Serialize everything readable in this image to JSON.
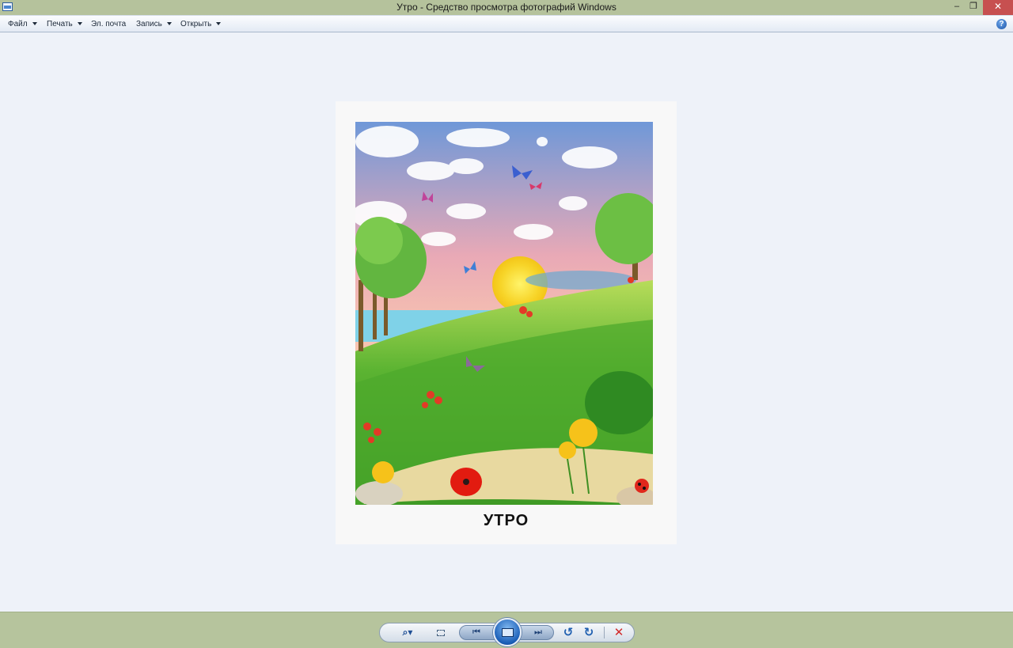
{
  "window": {
    "title": "Утро - Средство просмотра фотографий Windows",
    "minimize_glyph": "–",
    "restore_glyph": "❐",
    "close_glyph": "✕"
  },
  "menu": {
    "items": [
      {
        "label": "Файл",
        "has_dropdown": true
      },
      {
        "label": "Печать",
        "has_dropdown": true
      },
      {
        "label": "Эл. почта",
        "has_dropdown": false
      },
      {
        "label": "Запись",
        "has_dropdown": true
      },
      {
        "label": "Открыть",
        "has_dropdown": true
      }
    ],
    "help_glyph": "?"
  },
  "photo": {
    "caption": "УТРО"
  },
  "controls": {
    "zoom_glyph": "⌕▾",
    "prev_glyph": "⏮",
    "next_glyph": "⏭",
    "rotate_ccw_glyph": "↺",
    "rotate_cw_glyph": "↻",
    "delete_glyph": "✕"
  },
  "colors": {
    "titlebar": "#b5c29c",
    "close_button": "#c75050",
    "viewport_bg": "#eef2f9",
    "controlbar": "#b6c49d",
    "accent": "#1b5fb8"
  }
}
